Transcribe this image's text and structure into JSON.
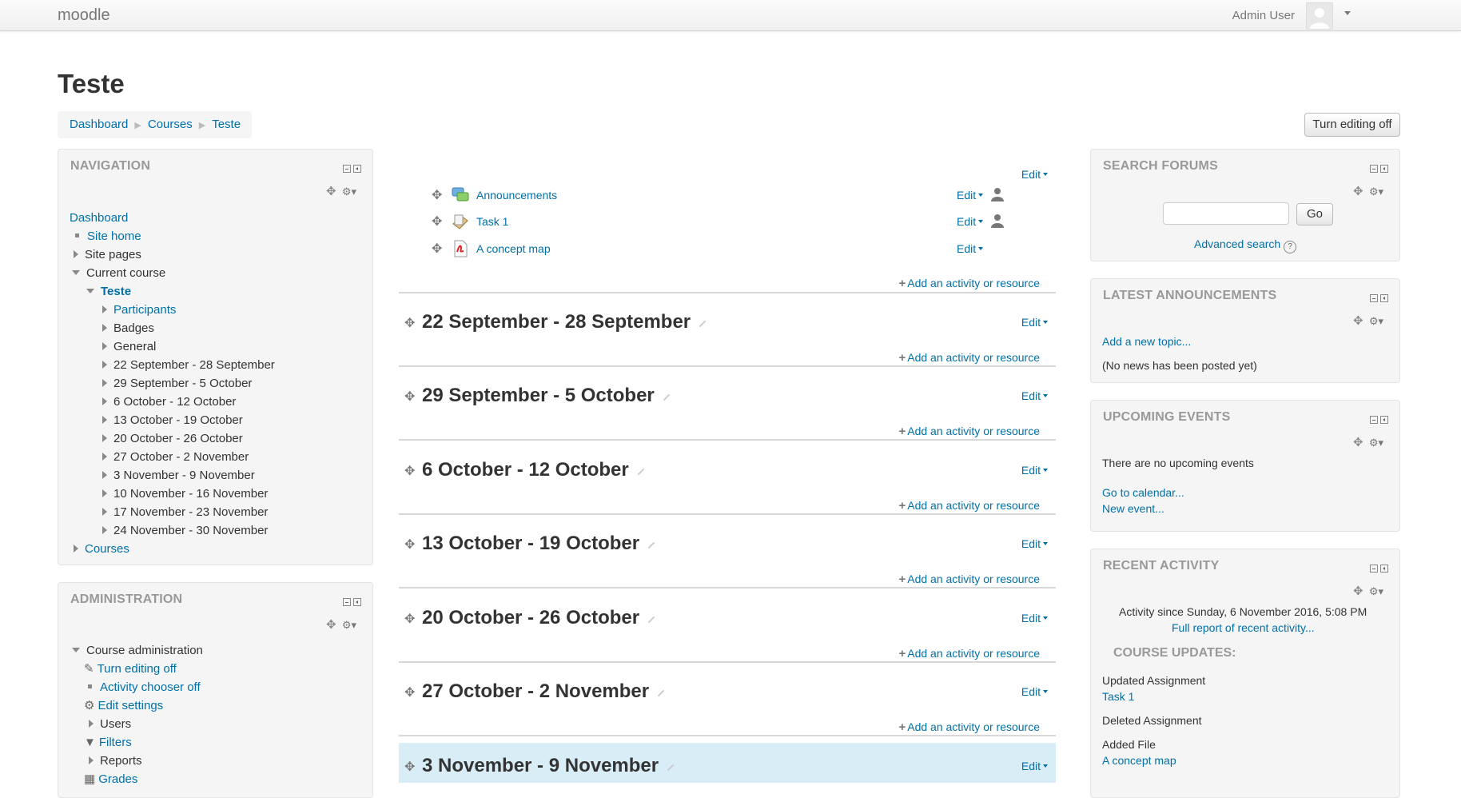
{
  "header": {
    "brand": "moodle",
    "user_name": "Admin User"
  },
  "page": {
    "title": "Teste",
    "breadcrumb": [
      "Dashboard",
      "Courses",
      "Teste"
    ],
    "turn_editing_button": "Turn editing off"
  },
  "navigation": {
    "title": "NAVIGATION",
    "dashboard": "Dashboard",
    "site_home": "Site home",
    "site_pages": "Site pages",
    "current_course": "Current course",
    "course": "Teste",
    "course_items": [
      "Participants",
      "Badges",
      "General",
      "22 September - 28 September",
      "29 September - 5 October",
      "6 October - 12 October",
      "13 October - 19 October",
      "20 October - 26 October",
      "27 October - 2 November",
      "3 November - 9 November",
      "10 November - 16 November",
      "17 November - 23 November",
      "24 November - 30 November"
    ],
    "courses": "Courses"
  },
  "administration": {
    "title": "ADMINISTRATION",
    "course_administration": "Course administration",
    "items": [
      "Turn editing off",
      "Activity chooser off",
      "Edit settings",
      "Users",
      "Filters",
      "Reports",
      "Grades"
    ]
  },
  "content": {
    "edit_label": "Edit",
    "add_activity_label": "Add an activity or resource",
    "activities": [
      "Announcements",
      "Task 1",
      "A concept map"
    ],
    "sections": [
      "22 September - 28 September",
      "29 September - 5 October",
      "6 October - 12 October",
      "13 October - 19 October",
      "20 October - 26 October",
      "27 October - 2 November",
      "3 November - 9 November"
    ]
  },
  "search_forums": {
    "title": "SEARCH FORUMS",
    "go_label": "Go",
    "advanced_search": "Advanced search",
    "help_glyph": "?"
  },
  "latest_announcements": {
    "title": "LATEST ANNOUNCEMENTS",
    "add_topic": "Add a new topic...",
    "no_news": "(No news has been posted yet)"
  },
  "upcoming_events": {
    "title": "UPCOMING EVENTS",
    "none": "There are no upcoming events",
    "go_to_calendar": "Go to calendar...",
    "new_event": "New event..."
  },
  "recent_activity": {
    "title": "RECENT ACTIVITY",
    "since": "Activity since Sunday, 6 November 2016, 5:08 PM",
    "full_report": "Full report of recent activity...",
    "course_updates": "COURSE UPDATES:",
    "updated_assignment": "Updated Assignment",
    "task": "Task 1",
    "deleted_assignment": "Deleted Assignment",
    "added_file": "Added File",
    "concept_map": "A concept map"
  },
  "colors": {
    "link": "#0070a8",
    "current_section_bg": "#d9edf7",
    "block_bg": "#f5f5f5"
  }
}
